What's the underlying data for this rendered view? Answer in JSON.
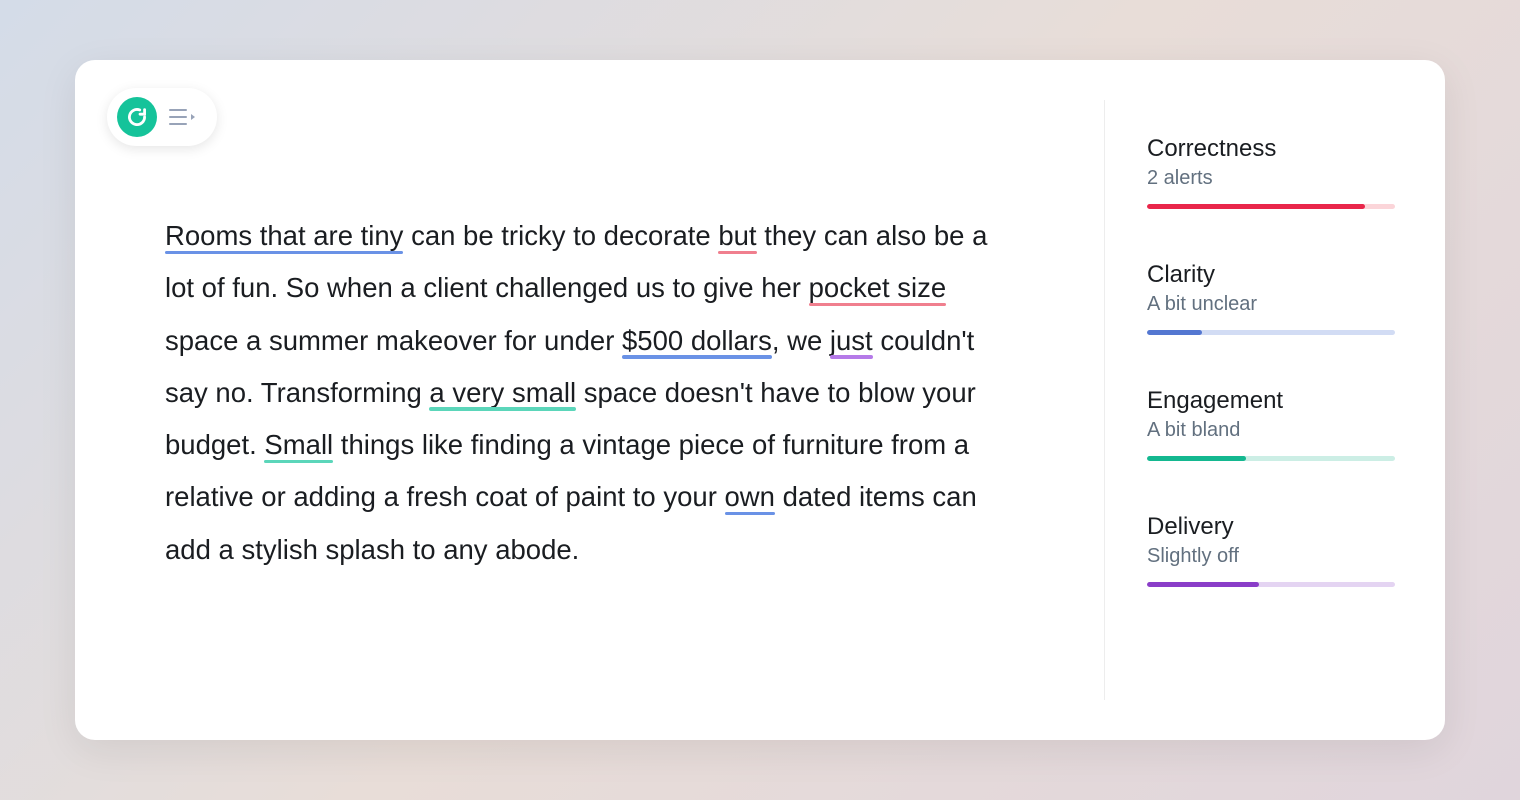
{
  "editor": {
    "segments": [
      {
        "text": "Rooms that are tiny",
        "underline": "blue"
      },
      {
        "text": " can be tricky to decorate "
      },
      {
        "text": "but",
        "underline": "red"
      },
      {
        "text": " they can also be a lot of fun.  So when a client challenged us to give her "
      },
      {
        "text": "pocket size",
        "underline": "red"
      },
      {
        "text": " space a summer makeover for under "
      },
      {
        "text": "$500 dollars",
        "underline": "blue"
      },
      {
        "text": ", we "
      },
      {
        "text": "just",
        "underline": "purple"
      },
      {
        "text": " couldn't say no. Transforming "
      },
      {
        "text": "a very small",
        "underline": "teal"
      },
      {
        "text": " space doesn't have to blow your budget. "
      },
      {
        "text": "Small",
        "underline": "teal"
      },
      {
        "text": " things like finding a vintage piece of furniture from a relative or adding a fresh coat of paint to your "
      },
      {
        "text": "own",
        "underline": "blue"
      },
      {
        "text": " dated items can add a stylish splash to any abode."
      }
    ]
  },
  "sidebar": {
    "metrics": [
      {
        "key": "correctness",
        "title": "Correctness",
        "subtitle": "2 alerts",
        "color": "red",
        "progress": 88
      },
      {
        "key": "clarity",
        "title": "Clarity",
        "subtitle": "A bit unclear",
        "color": "blue",
        "progress": 22
      },
      {
        "key": "engagement",
        "title": "Engagement",
        "subtitle": "A bit bland",
        "color": "teal",
        "progress": 40
      },
      {
        "key": "delivery",
        "title": "Delivery",
        "subtitle": "Slightly off",
        "color": "purple",
        "progress": 45
      }
    ]
  }
}
